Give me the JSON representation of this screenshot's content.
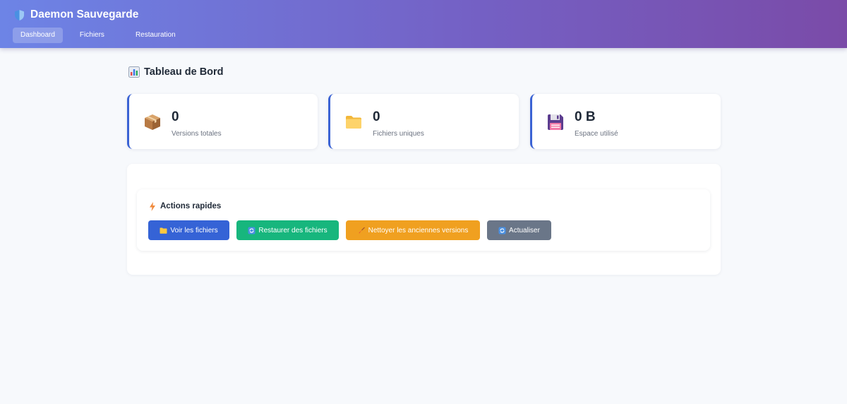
{
  "app": {
    "title": "Daemon Sauvegarde",
    "brand_icon": "shield-icon",
    "colors": {
      "header_start": "#6d84e6",
      "header_end": "#7a4ba8",
      "accent": "#3b63d4"
    }
  },
  "nav": {
    "items": [
      {
        "label": "Dashboard",
        "active": true
      },
      {
        "label": "Fichiers",
        "active": false
      },
      {
        "label": "Restauration",
        "active": false
      }
    ]
  },
  "page": {
    "title": "Tableau de Bord",
    "title_icon": "bar-chart-icon"
  },
  "stats": [
    {
      "value": "0",
      "label": "Versions totales",
      "icon": "package-icon"
    },
    {
      "value": "0",
      "label": "Fichiers uniques",
      "icon": "folder-icon"
    },
    {
      "value": "0 B",
      "label": "Espace utilisé",
      "icon": "floppy-disk-icon"
    }
  ],
  "actions": {
    "title": "Actions rapides",
    "title_icon": "lightning-icon",
    "buttons": [
      {
        "label": "Voir les fichiers",
        "icon": "folder-icon",
        "color": "#3563d6"
      },
      {
        "label": "Restaurer des fichiers",
        "icon": "refresh-icon",
        "color": "#17b67d"
      },
      {
        "label": "Nettoyer les anciennes versions",
        "icon": "broom-icon",
        "color": "#f0a020"
      },
      {
        "label": "Actualiser",
        "icon": "refresh-icon",
        "color": "#6a7688"
      }
    ]
  }
}
